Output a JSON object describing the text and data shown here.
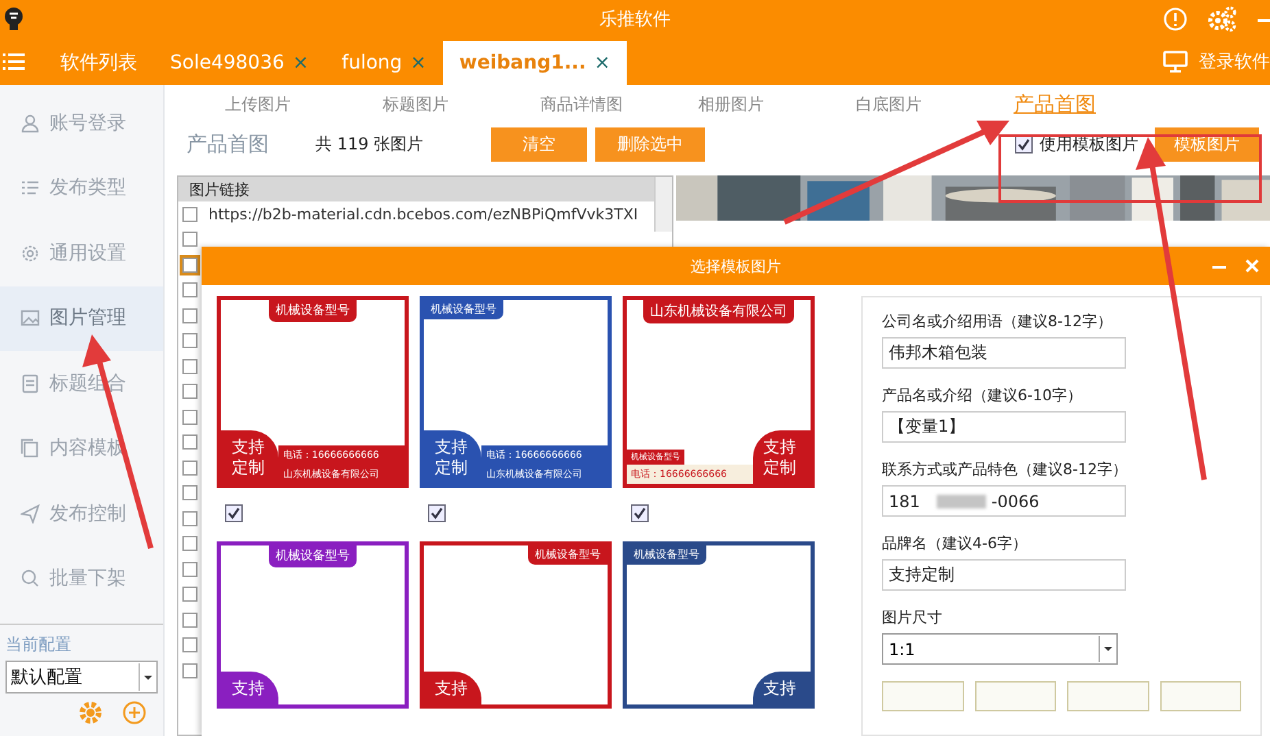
{
  "window": {
    "title": "乐推软件"
  },
  "tabs": [
    {
      "label": "软件列表",
      "selected": false
    },
    {
      "label": "Sole498036",
      "close": "×",
      "selected": false
    },
    {
      "label": "fulong",
      "close": "×",
      "selected": false
    },
    {
      "label": "weibang1...",
      "close": "×",
      "selected": true
    }
  ],
  "login": {
    "label": "登录软件"
  },
  "sidebar": {
    "items": [
      {
        "label": "账号登录",
        "selected": false
      },
      {
        "label": "发布类型",
        "selected": false
      },
      {
        "label": "通用设置",
        "selected": false
      },
      {
        "label": "图片管理",
        "selected": true
      },
      {
        "label": "标题组合",
        "selected": false
      },
      {
        "label": "内容模板",
        "selected": false
      },
      {
        "label": "发布控制",
        "selected": false
      },
      {
        "label": "批量下架",
        "selected": false
      }
    ],
    "config_label": "当前配置",
    "config_value": "默认配置"
  },
  "sub_tabs": [
    {
      "label": "上传图片",
      "selected": false
    },
    {
      "label": "标题图片",
      "selected": false
    },
    {
      "label": "商品详情图",
      "selected": false
    },
    {
      "label": "相册图片",
      "selected": false
    },
    {
      "label": "白底图片",
      "selected": false
    },
    {
      "label": "产品首图",
      "selected": true
    }
  ],
  "toolbar": {
    "title": "产品首图",
    "count": "共 119 张图片",
    "buttons": [
      "清空",
      "删除选中"
    ],
    "use_template": {
      "label": "使用模板图片",
      "checked": true
    },
    "template_button": "模板图片"
  },
  "table": {
    "column": "图片链接",
    "rows": [
      {
        "url": "https://b2b-material.cdn.bcebos.com/ezNBPiQmfVvk3TXI",
        "checked": false,
        "focused": false
      },
      {
        "checked": false,
        "focused": false
      },
      {
        "checked": false,
        "focused": true
      },
      {
        "checked": false,
        "focused": false
      },
      {
        "checked": false,
        "focused": false
      },
      {
        "checked": false,
        "focused": false
      },
      {
        "checked": false,
        "focused": false
      },
      {
        "checked": false,
        "focused": false
      },
      {
        "checked": false,
        "focused": false
      },
      {
        "checked": false,
        "focused": false
      },
      {
        "checked": false,
        "focused": false
      },
      {
        "checked": false,
        "focused": false
      },
      {
        "checked": false,
        "focused": false
      },
      {
        "checked": false,
        "focused": false
      },
      {
        "checked": false,
        "focused": false
      },
      {
        "checked": false,
        "focused": false
      },
      {
        "checked": false,
        "focused": false
      },
      {
        "checked": false,
        "focused": false
      },
      {
        "checked": false,
        "focused": false
      }
    ]
  },
  "dialog": {
    "title": "选择模板图片",
    "template_rows": [
      {
        "templates": [
          {
            "kind": "center",
            "color": "#c8161d",
            "tag": "机械设备型号",
            "badge": "支持定制",
            "phone": "电话：16666666666",
            "company": "山东机械设备有限公司",
            "checked": true
          },
          {
            "kind": "corner",
            "color": "#2a52b0",
            "tag": "机械设备型号",
            "badge": "支持定制",
            "phone": "电话：16666666666",
            "company": "山东机械设备有限公司",
            "checked": true
          },
          {
            "kind": "banner",
            "color": "#c8161d",
            "tag": "山东机械设备有限公司",
            "badge": "支持定制",
            "sub_tag": "机械设备型号",
            "phone": "电话：16666666666",
            "checked": true
          }
        ]
      },
      {
        "templates": [
          {
            "kind": "center",
            "color": "#8a1fc0",
            "tag": "机械设备型号",
            "badge": "支持"
          },
          {
            "kind": "flag",
            "color": "#c8161d",
            "tag": "机械设备型号",
            "badge": "支持"
          },
          {
            "kind": "edge",
            "color": "#2a4a8a",
            "tag": "机械设备型号",
            "badge": "支持"
          }
        ]
      }
    ],
    "form": {
      "fields": [
        {
          "label": "公司名或介绍用语（建议8-12字）",
          "value": "伟邦木箱包装"
        },
        {
          "label": "产品名或介绍（建议6-10字）",
          "value": "【变量1】"
        },
        {
          "label": "联系方式或产品特色（建议8-12字）",
          "value": "181",
          "value_end": "-0066",
          "redacted": true
        },
        {
          "label": "品牌名（建议4-6字）",
          "value": "支持定制"
        }
      ],
      "size": {
        "label": "图片尺寸",
        "value": "1:1"
      }
    }
  }
}
